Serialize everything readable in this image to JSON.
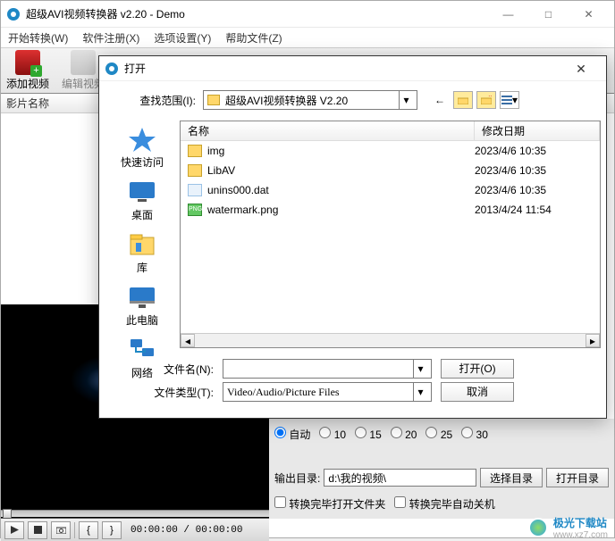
{
  "main": {
    "title": "超级AVI视频转换器 v2.20 - Demo",
    "menu": [
      "开始转换(W)",
      "软件注册(X)",
      "选项设置(Y)",
      "帮助文件(Z)"
    ],
    "toolbar": {
      "add_video": "添加视频",
      "edit_video": "编辑视频"
    },
    "list_header": "影片名称"
  },
  "player": {
    "time": "00:00:00 / 00:00:00"
  },
  "settings": {
    "radio_auto": "自动",
    "radios": [
      "10",
      "15",
      "20",
      "25",
      "30"
    ],
    "output_label": "输出目录:",
    "output_path": "d:\\我的视频\\",
    "choose_dir": "选择目录",
    "open_dir": "打开目录",
    "opt1": "转换完毕打开文件夹",
    "opt2": "转换完毕自动关机"
  },
  "dialog": {
    "title": "打开",
    "lookin_label": "查找范围(I):",
    "lookin_value": "超级AVI视频转换器 V2.20",
    "sidebar": {
      "s0": "快速访问",
      "s1": "桌面",
      "s2": "库",
      "s3": "此电脑",
      "s4": "网络"
    },
    "headers": {
      "name": "名称",
      "date": "修改日期"
    },
    "files": {
      "r0": {
        "name": "img",
        "date": "2023/4/6 10:35"
      },
      "r1": {
        "name": "LibAV",
        "date": "2023/4/6 10:35"
      },
      "r2": {
        "name": "unins000.dat",
        "date": "2023/4/6 10:35"
      },
      "r3": {
        "name": "watermark.png",
        "date": "2013/4/24 11:54"
      }
    },
    "filename_label": "文件名(N):",
    "filename_value": "",
    "filetype_label": "文件类型(T):",
    "filetype_value": "Video/Audio/Picture Files",
    "open_btn": "打开(O)",
    "cancel_btn": "取消"
  },
  "watermark": {
    "text": "极光下载站",
    "sub": "www.xz7.com"
  }
}
